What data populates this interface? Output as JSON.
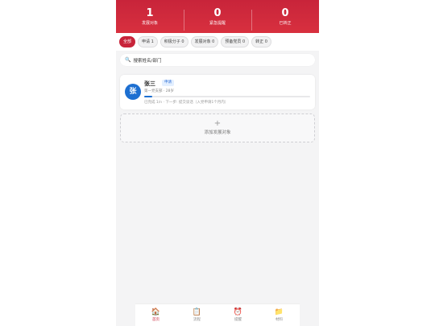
{
  "stats": [
    {
      "value": "1",
      "label": "发展对象"
    },
    {
      "value": "0",
      "label": "紧急提醒"
    },
    {
      "value": "0",
      "label": "已转正"
    }
  ],
  "filters": [
    {
      "label": "全部",
      "active": true
    },
    {
      "label": "申请 1"
    },
    {
      "label": "积极分子 0"
    },
    {
      "label": "发展对象 0"
    },
    {
      "label": "预备党员 0"
    },
    {
      "label": "转正 0"
    }
  ],
  "search": {
    "placeholder": "搜索姓名/部门"
  },
  "person": {
    "avatar": "张",
    "name": "张三",
    "badge": "申请",
    "info": "第一党支部 · 28岁",
    "progress": 0.05,
    "stage": "已完成 1/n · 下一步: 提交谈话（入党申请1个月内）"
  },
  "add": {
    "plus": "+",
    "label": "添加发展对象"
  },
  "tabs": [
    {
      "icon": "🏠",
      "label": "首页",
      "active": true
    },
    {
      "icon": "📋",
      "label": "流程"
    },
    {
      "icon": "⏰",
      "label": "提醒"
    },
    {
      "icon": "📁",
      "label": "材料"
    }
  ],
  "colors": {
    "brand": "#c8243a",
    "avatar": "#1d6fd1"
  }
}
